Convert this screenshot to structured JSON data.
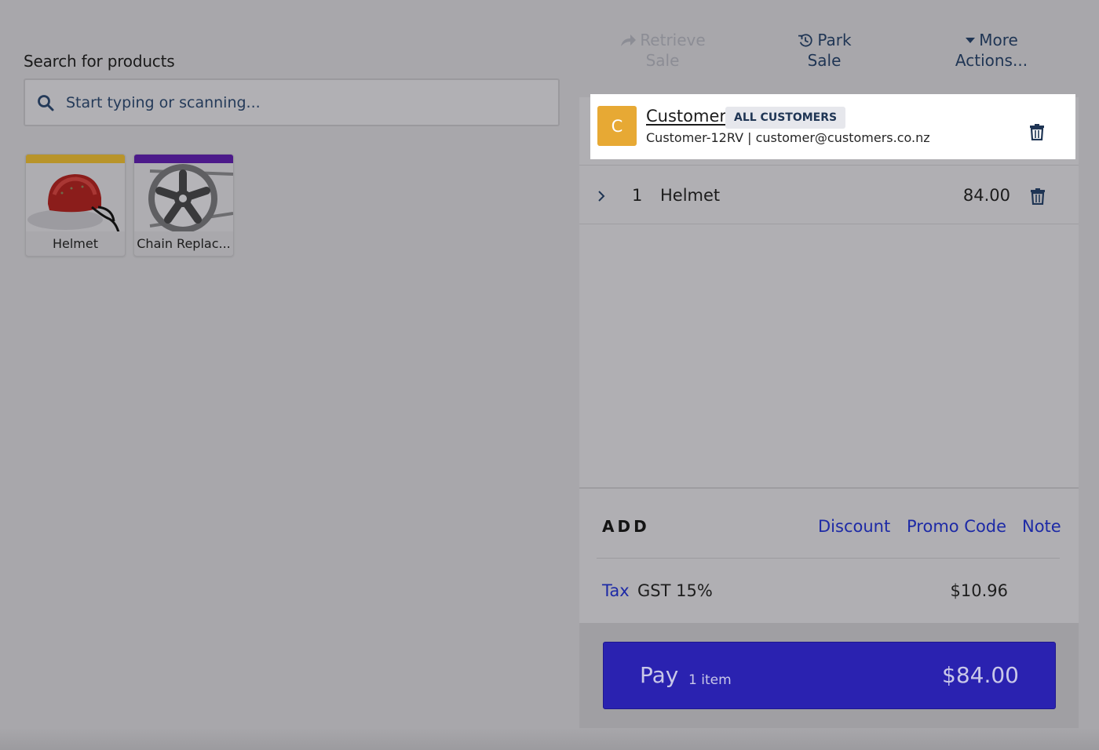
{
  "search": {
    "label": "Search for products",
    "placeholder": "Start typing or scanning..."
  },
  "products": [
    {
      "name": "Helmet",
      "bar_color": "#b8942a"
    },
    {
      "name": "Chain Replac...",
      "bar_color": "#4c1a8a"
    }
  ],
  "actions": {
    "retrieve_line1": "Retrieve",
    "retrieve_line2": "Sale",
    "park_line1": "Park",
    "park_line2": "Sale",
    "more_line1": "More",
    "more_line2": "Actions..."
  },
  "customer": {
    "initial": "C",
    "name": "Customer",
    "badge": "ALL CUSTOMERS",
    "meta": "Customer-12RV | customer@customers.co.nz"
  },
  "line_items": [
    {
      "qty": "1",
      "name": "Helmet",
      "price": "84.00"
    }
  ],
  "add": {
    "label": "ADD",
    "discount": "Discount",
    "promo": "Promo Code",
    "note": "Note"
  },
  "tax": {
    "link": "Tax",
    "name": "GST 15%",
    "amount": "$10.96"
  },
  "pay": {
    "label": "Pay",
    "count": "1 item",
    "total": "$84.00"
  },
  "colors": {
    "accent": "#1d2aa6",
    "pay_button": "#2a22b0",
    "avatar": "#e7a934",
    "overlay": "#a8a7ab"
  }
}
